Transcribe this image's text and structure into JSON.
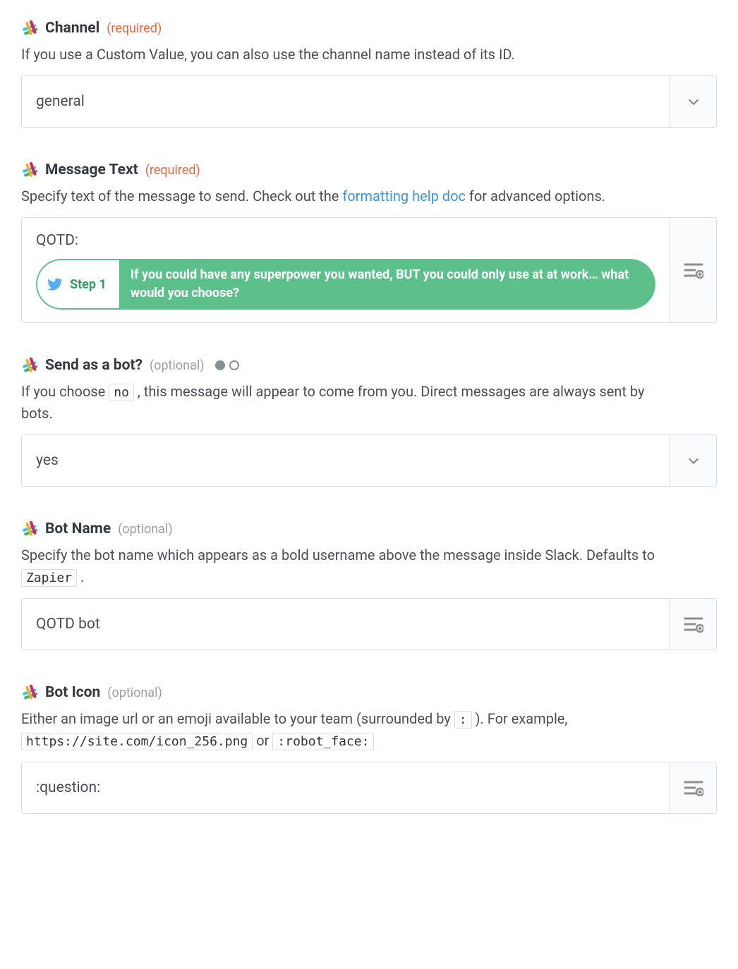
{
  "fields": {
    "channel": {
      "label": "Channel",
      "tag": "(required)",
      "desc_pre": "If you use a Custom Value, you can also use the channel name instead of its ID.",
      "value": "general"
    },
    "message": {
      "label": "Message Text",
      "tag": "(required)",
      "desc_before_link": "Specify text of the message to send. Check out the ",
      "link_text": "formatting help doc",
      "desc_after_link": " for advanced options.",
      "prefix_text": "QOTD:",
      "pill_step": "Step 1",
      "pill_body": "If you could have any superpower you wanted, BUT you could only use at at work… what would you choose?"
    },
    "sendbot": {
      "label": "Send as a bot?",
      "tag": "(optional)",
      "desc_before_code": "If you choose ",
      "code1": "no",
      "desc_after_code": " , this message will appear to come from you. Direct messages are always sent by bots.",
      "value": "yes"
    },
    "botname": {
      "label": "Bot Name",
      "tag": "(optional)",
      "desc_before_code": "Specify the bot name which appears as a bold username above the message inside Slack. Defaults to ",
      "code1": "Zapier",
      "desc_after_code": " .",
      "value": "QOTD bot"
    },
    "boticon": {
      "label": "Bot Icon",
      "tag": "(optional)",
      "desc_seg1": "Either an image url or an emoji available to your team (surrounded by ",
      "code1": ":",
      "desc_seg2": " ). For example, ",
      "code2": "https://site.com/icon_256.png",
      "desc_seg3": " or ",
      "code3": ":robot_face:",
      "value": ":question:"
    }
  }
}
